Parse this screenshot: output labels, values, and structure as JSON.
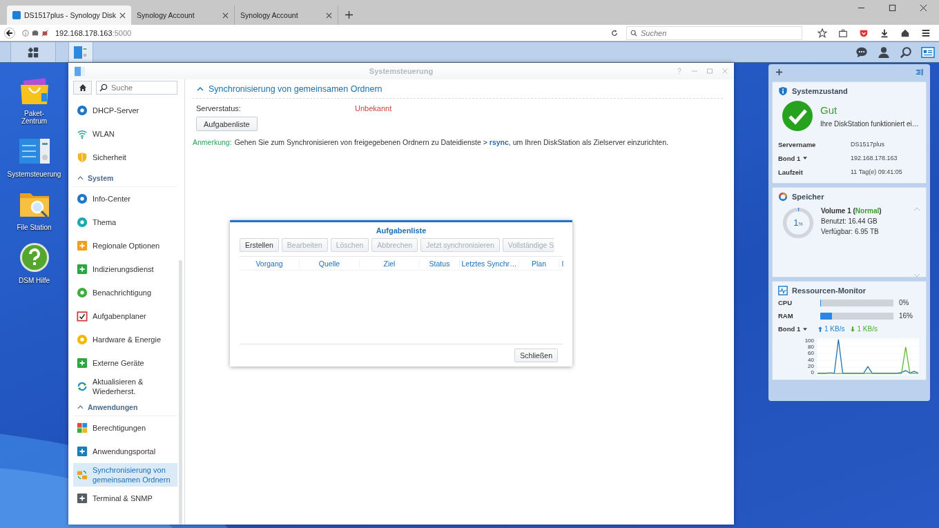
{
  "browser": {
    "tabs": [
      {
        "title": "DS1517plus - Synology Disk",
        "selected": true,
        "favicon": true
      },
      {
        "title": "Synology Account",
        "selected": false,
        "favicon": false
      },
      {
        "title": "Synology Account",
        "selected": false,
        "favicon": false
      }
    ],
    "address": {
      "host": "192.168.178.163",
      "port": ":5000"
    },
    "search": {
      "placeholder": "Suchen"
    }
  },
  "taskbar": {
    "items": [
      {
        "kind": "menu",
        "selected": false
      },
      {
        "kind": "control-panel",
        "selected": true
      }
    ]
  },
  "desktop_icons": [
    {
      "kind": "package",
      "lines": [
        "Paket-",
        "Zentrum"
      ]
    },
    {
      "kind": "control-panel",
      "lines": [
        "Systemsteuerung"
      ]
    },
    {
      "kind": "folder",
      "lines": [
        "File Station"
      ]
    },
    {
      "kind": "help",
      "lines": [
        "DSM Hilfe"
      ]
    }
  ],
  "window": {
    "title": "Systemsteuerung",
    "sidebar": {
      "search": {
        "placeholder": "Suche"
      },
      "items": [
        {
          "kind": "item",
          "label": "DHCP-Server",
          "selected": false
        },
        {
          "kind": "item",
          "label": "WLAN",
          "selected": false
        },
        {
          "kind": "item",
          "label": "Sicherheit",
          "selected": false
        },
        {
          "kind": "section",
          "label": "System",
          "expanded": true
        },
        {
          "kind": "item",
          "label": "Info-Center",
          "selected": false
        },
        {
          "kind": "item",
          "label": "Thema",
          "selected": false
        },
        {
          "kind": "item",
          "label": "Regionale Optionen",
          "selected": false
        },
        {
          "kind": "item",
          "label": "Indizierungsdienst",
          "selected": false
        },
        {
          "kind": "item",
          "label": "Benachrichtigung",
          "selected": false
        },
        {
          "kind": "item",
          "label": "Aufgabenplaner",
          "selected": false
        },
        {
          "kind": "item",
          "label": "Hardware & Energie",
          "selected": false
        },
        {
          "kind": "item",
          "label": "Externe Geräte",
          "selected": false
        },
        {
          "kind": "item",
          "label": "Aktualisieren & Wiederherst.",
          "selected": false
        },
        {
          "kind": "section",
          "label": "Anwendungen",
          "expanded": true
        },
        {
          "kind": "item",
          "label": "Berechtigungen",
          "selected": false
        },
        {
          "kind": "item",
          "label": "Anwendungsportal",
          "selected": false
        },
        {
          "kind": "item",
          "label": "Synchronisierung von gemeinsamen Ordnern",
          "selected": true
        },
        {
          "kind": "item",
          "label": "Terminal & SNMP",
          "selected": false
        }
      ]
    },
    "content": {
      "section": {
        "title": "Synchronisierung von gemeinsamen Ordnern",
        "expanded": true
      },
      "server_status": {
        "label": "Serverstatus:",
        "value": "Unbekannt"
      },
      "button": "Aufgabenliste",
      "note": {
        "label": "Anmerkung:",
        "text": "Gehen Sie zum Synchronisieren von freigegebenen Ordnern zu Dateidienste > **rsync**, um Ihren DiskStation als Zielserver einzurichten."
      }
    },
    "dialog": {
      "title": "Aufgabenliste",
      "buttons": [
        {
          "label": "Erstellen",
          "disabled": false
        },
        {
          "label": "Bearbeiten",
          "disabled": true
        },
        {
          "label": "Löschen",
          "disabled": true
        },
        {
          "label": "Abbrechen",
          "disabled": true
        },
        {
          "label": "Jetzt synchronisieren",
          "disabled": true
        },
        {
          "label": "Vollständige S",
          "disabled": true
        }
      ],
      "columns": [
        "Vorgang",
        "Quelle",
        "Ziel",
        "Status",
        "Letztes Synchr…",
        "Plan",
        "I"
      ],
      "close_button": "Schließen"
    }
  },
  "widgets": {
    "health": {
      "title": "Systemzustand",
      "status": "Gut",
      "message": "Ihre DiskStation funktioniert ei…",
      "rows": [
        {
          "label": "Servername",
          "value": "DS1517plus",
          "dropdown": false
        },
        {
          "label": "Bond 1",
          "value": "192.168.178.163",
          "dropdown": true
        },
        {
          "label": "Laufzeit",
          "value": "11 Tag(e) 09:41:05",
          "dropdown": false
        }
      ]
    },
    "storage": {
      "title": "Speicher",
      "percent": "1",
      "unit": "%",
      "level": 0.01,
      "volume": "Volume 1 (**Normal**)",
      "used": "Benutzt: 16.44 GB",
      "free": "Verfügbar: 6.95 TB"
    },
    "resources": {
      "title": "Ressourcen-Monitor",
      "meters": [
        {
          "label": "CPU",
          "level": 0,
          "reading": "0%"
        },
        {
          "label": "RAM",
          "level": 0.16,
          "reading": "16%"
        }
      ],
      "network": {
        "label": "Bond 1",
        "up": "1 KB/s",
        "down": "1 KB/s"
      },
      "chart_data": {
        "type": "line",
        "ylim": [
          0,
          100
        ],
        "yticks": [
          0,
          20,
          40,
          60,
          80,
          100
        ],
        "series": [
          {
            "color": "#1f6fb2",
            "values": [
              3,
              3,
              3,
              4,
              3,
              100,
              3,
              3,
              3,
              3,
              3,
              3,
              22,
              3,
              3,
              3,
              3,
              3,
              3,
              3,
              5,
              10,
              3,
              8,
              3
            ]
          },
          {
            "color": "#5cb82f",
            "values": [
              2,
              2,
              2,
              3,
              2,
              2,
              2,
              2,
              2,
              2,
              2,
              2,
              3,
              2,
              2,
              2,
              2,
              2,
              2,
              2,
              2,
              78,
              2,
              3,
              2
            ]
          }
        ]
      }
    }
  }
}
